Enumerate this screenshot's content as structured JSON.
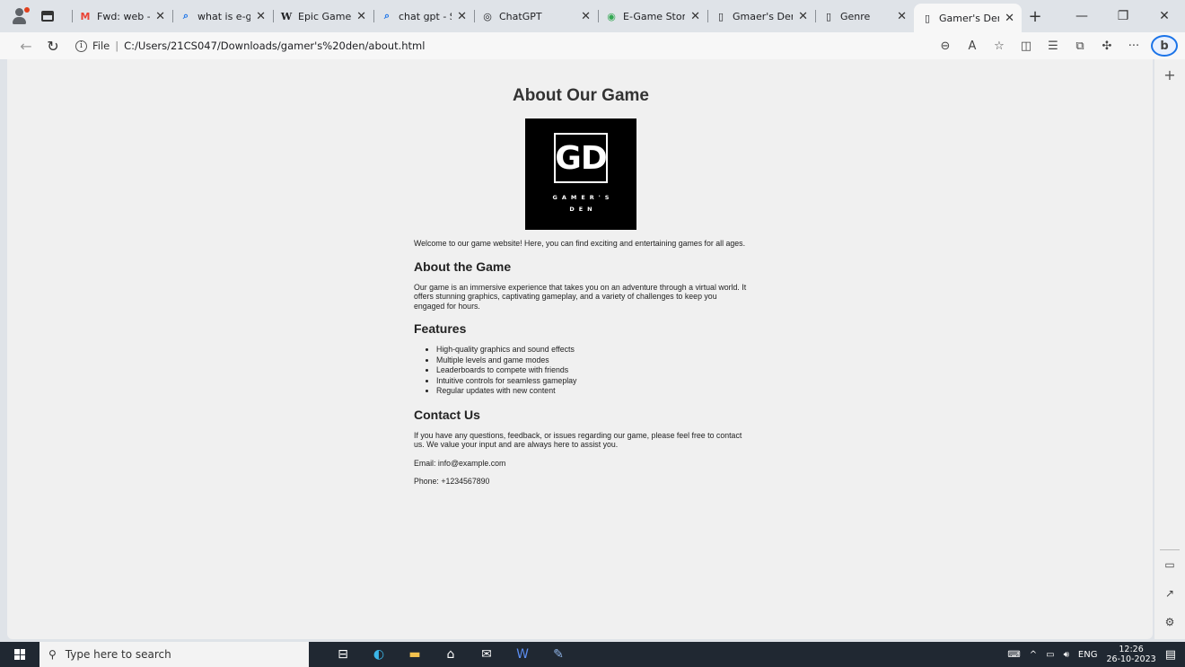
{
  "tabs": [
    {
      "title": "Fwd: web - lak",
      "favicon": "M",
      "favicon_color": "#ea4335"
    },
    {
      "title": "what is e-game",
      "favicon": "⌕",
      "favicon_color": "#1a73e8"
    },
    {
      "title": "Epic Games Sto",
      "favicon": "W",
      "favicon_color": "#333333"
    },
    {
      "title": "chat gpt - Sear",
      "favicon": "⌕",
      "favicon_color": "#1a73e8"
    },
    {
      "title": "ChatGPT",
      "favicon": "◎",
      "favicon_color": "#333333"
    },
    {
      "title": "E-Game Store (",
      "favicon": "◉",
      "favicon_color": "#34a853"
    },
    {
      "title": "Gmaer's Den",
      "favicon": "▯",
      "favicon_color": "#555555"
    },
    {
      "title": "Genre",
      "favicon": "▯",
      "favicon_color": "#555555"
    },
    {
      "title": "Gamer's Den -",
      "favicon": "▯",
      "favicon_color": "#555555"
    }
  ],
  "address": {
    "scheme_label": "File",
    "url": "C:/Users/21CS047/Downloads/gamer's%20den/about.html"
  },
  "page": {
    "title": "About Our Game",
    "logo_mark": "GD",
    "logo_line1": "GAMER'S",
    "logo_line2": "DEN",
    "intro": "Welcome to our game website! Here, you can find exciting and entertaining games for all ages.",
    "about_heading": "About the Game",
    "about_text": "Our game is an immersive experience that takes you on an adventure through a virtual world. It offers stunning graphics, captivating gameplay, and a variety of challenges to keep you engaged for hours.",
    "features_heading": "Features",
    "features": [
      "High-quality graphics and sound effects",
      "Multiple levels and game modes",
      "Leaderboards to compete with friends",
      "Intuitive controls for seamless gameplay",
      "Regular updates with new content"
    ],
    "contact_heading": "Contact Us",
    "contact_text": "If you have any questions, feedback, or issues regarding our game, please feel free to contact us. We value your input and are always here to assist you.",
    "email": "Email: info@example.com",
    "phone": "Phone: +1234567890"
  },
  "taskbar": {
    "search_placeholder": "Type here to search",
    "language": "ENG",
    "time": "12:26",
    "date": "26-10-2023"
  }
}
